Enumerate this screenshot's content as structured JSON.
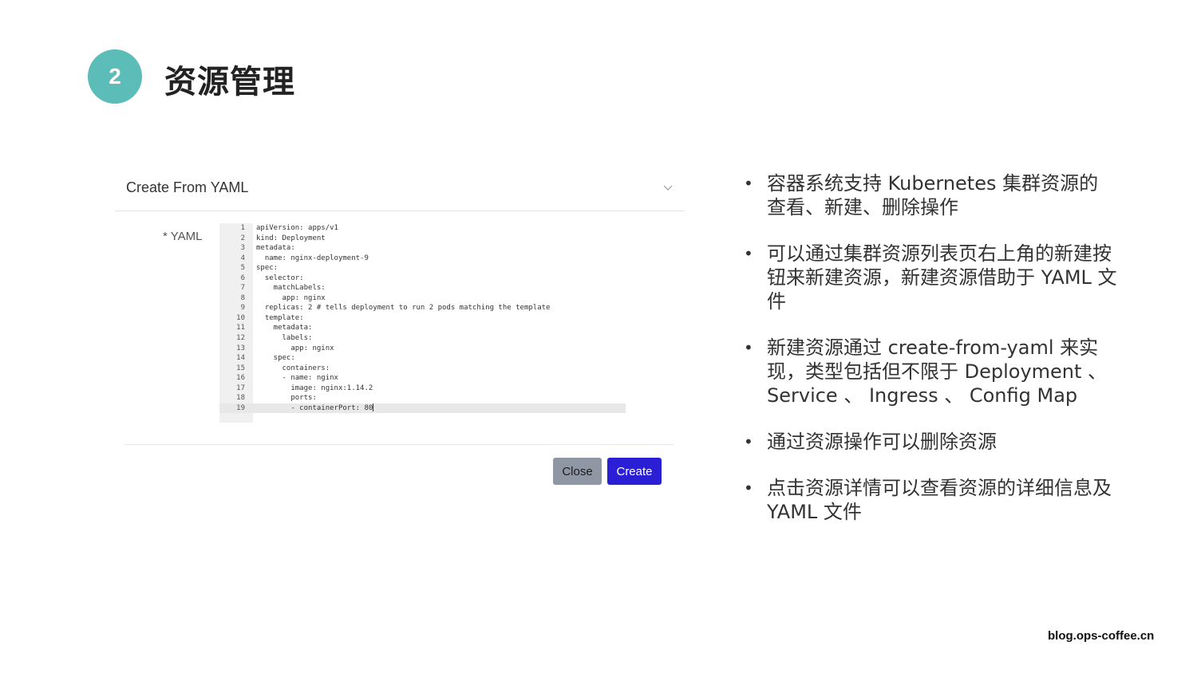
{
  "slide": {
    "number": "2",
    "title": "资源管理",
    "footer_url": "blog.ops-coffee.cn"
  },
  "dialog": {
    "title": "Create From YAML",
    "chevron_icon": "chevron-down-icon",
    "yaml_label": "* YAML",
    "close_label": "Close",
    "create_label": "Create",
    "colors": {
      "create_button": "#2b1fd6",
      "close_button": "#8e97a3",
      "badge": "#5bbcb8"
    },
    "code_lines": [
      {
        "n": "1",
        "text": "apiVersion: apps/v1"
      },
      {
        "n": "2",
        "text": "kind: Deployment"
      },
      {
        "n": "3",
        "text": "metadata:"
      },
      {
        "n": "4",
        "text": "  name: nginx-deployment-9"
      },
      {
        "n": "5",
        "text": "spec:"
      },
      {
        "n": "6",
        "text": "  selector:"
      },
      {
        "n": "7",
        "text": "    matchLabels:"
      },
      {
        "n": "8",
        "text": "      app: nginx"
      },
      {
        "n": "9",
        "text": "  replicas: 2 # tells deployment to run 2 pods matching the template"
      },
      {
        "n": "10",
        "text": "  template:"
      },
      {
        "n": "11",
        "text": "    metadata:"
      },
      {
        "n": "12",
        "text": "      labels:"
      },
      {
        "n": "13",
        "text": "        app: nginx"
      },
      {
        "n": "14",
        "text": "    spec:"
      },
      {
        "n": "15",
        "text": "      containers:"
      },
      {
        "n": "16",
        "text": "      - name: nginx"
      },
      {
        "n": "17",
        "text": "        image: nginx:1.14.2"
      },
      {
        "n": "18",
        "text": "        ports:"
      },
      {
        "n": "19",
        "text": "        - containerPort: 80"
      }
    ]
  },
  "bullets": [
    "容器系统支持 Kubernetes 集群资源的查看、新建、删除操作",
    "可以通过集群资源列表页右上角的新建按钮来新建资源，新建资源借助于 YAML 文件",
    "新建资源通过 create-from-yaml 来实现，类型包括但不限于 Deployment 、 Service 、 Ingress 、 Config Map",
    "通过资源操作可以删除资源",
    "点击资源详情可以查看资源的详细信息及 YAML 文件"
  ]
}
